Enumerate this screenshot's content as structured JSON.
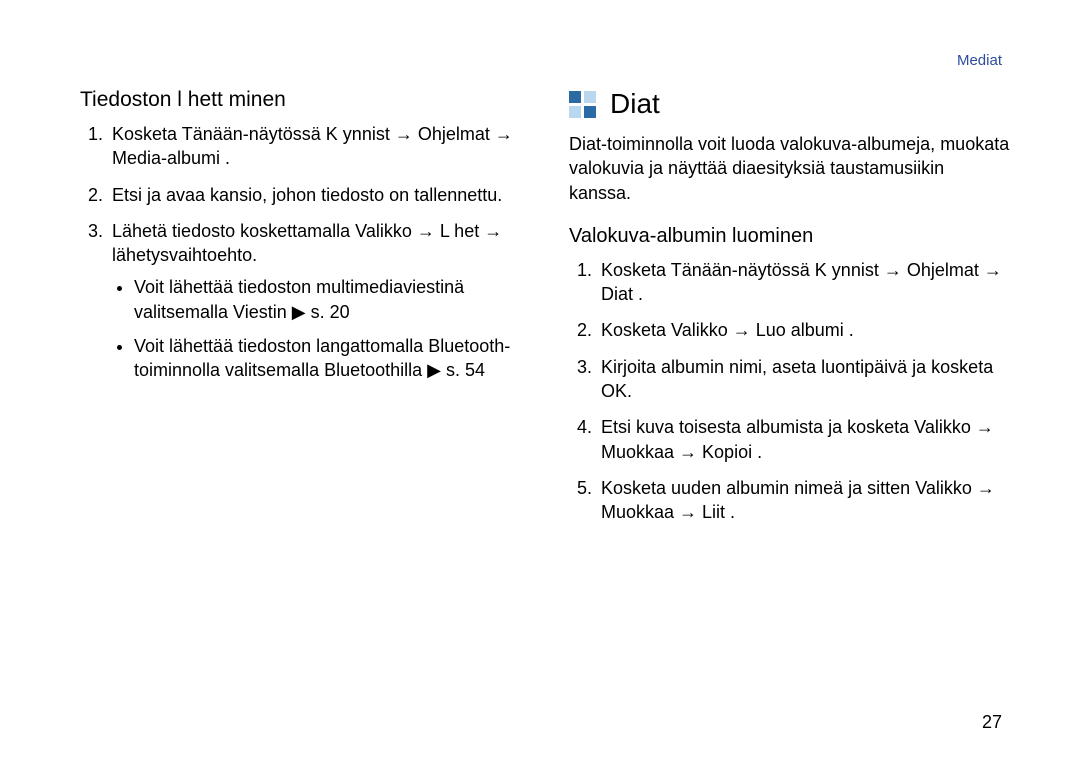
{
  "header": {
    "tag": "Mediat"
  },
  "page_number": "27",
  "left": {
    "heading": "Tiedoston l hett minen",
    "items": [
      {
        "t": "Kosketa Tänään-näytössä K ynnist → Ohjelmat → Media-albumi ."
      },
      {
        "t": "Etsi ja avaa kansio, johon tiedosto on tallennettu."
      },
      {
        "t": "Lähetä tiedosto koskettamalla Valikko → L het → lähetysvaihtoehto.",
        "bullets": [
          "Voit lähettää tiedoston multimediaviestinä valitsemalla Viestin ▶ s. 20",
          "Voit lähettää tiedoston langattomalla Bluetooth-toiminnolla valitsemalla Bluetoothilla ▶ s. 54"
        ]
      }
    ]
  },
  "right": {
    "heading": "Diat",
    "intro": "Diat-toiminnolla voit luoda valokuva-albumeja, muokata valokuvia ja näyttää diaesityksiä taustamusiikin kanssa.",
    "subheading": "Valokuva-albumin luominen",
    "items": [
      {
        "t": "Kosketa Tänään-näytössä K ynnist → Ohjelmat → Diat ."
      },
      {
        "t": "Kosketa Valikko → Luo albumi ."
      },
      {
        "t": "Kirjoita albumin nimi, aseta luontipäivä ja kosketa OK."
      },
      {
        "t": "Etsi kuva toisesta albumista ja kosketa Valikko → Muokkaa → Kopioi ."
      },
      {
        "t": "Kosketa uuden albumin nimeä ja sitten Valikko → Muokkaa → Liit ."
      }
    ]
  }
}
